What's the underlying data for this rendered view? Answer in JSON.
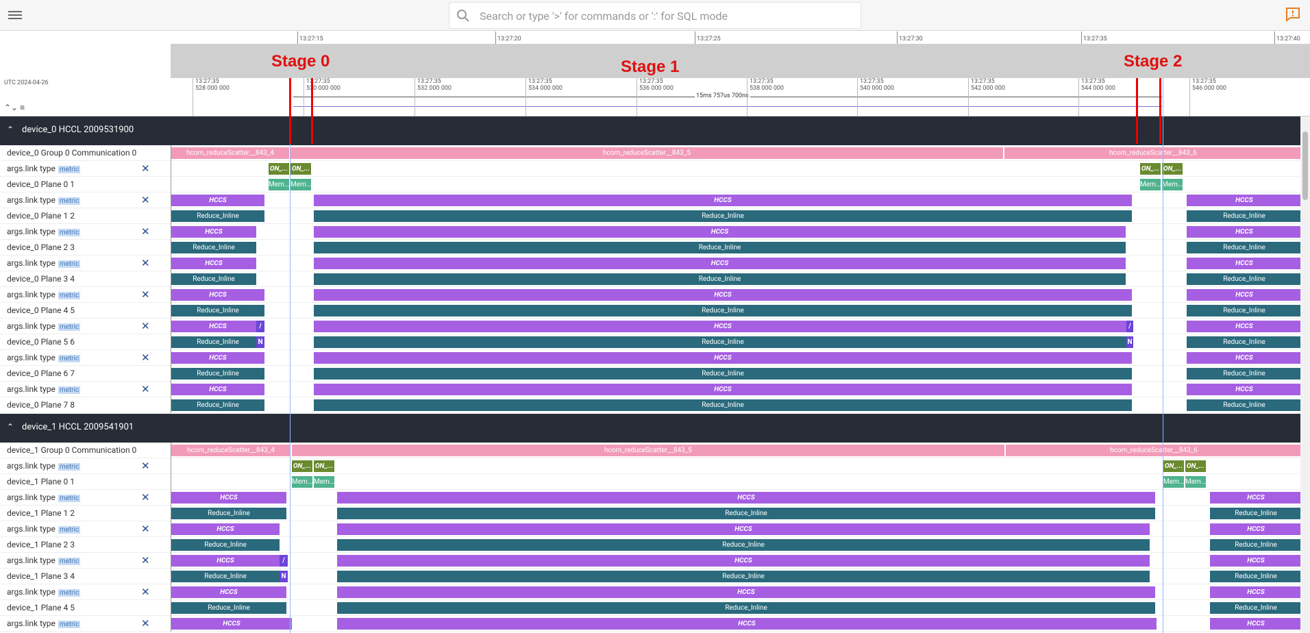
{
  "topbar": {
    "search_placeholder": "Search or type '>' for commands or ':' for SQL mode"
  },
  "overview": {
    "ticks": [
      "13:27:15",
      "13:27:20",
      "13:27:25",
      "13:27:30",
      "13:27:35",
      "13:27:40"
    ]
  },
  "timeaxis": {
    "utc": "UTC 2024-04-26",
    "ticks": [
      {
        "t": "13:27:35",
        "n": "528 000 000"
      },
      {
        "t": "13:27:35",
        "n": "530 000 000"
      },
      {
        "t": "13:27:35",
        "n": "532 000 000"
      },
      {
        "t": "13:27:35",
        "n": "534 000 000"
      },
      {
        "t": "13:27:35",
        "n": "536 000 000"
      },
      {
        "t": "13:27:35",
        "n": "538 000 000"
      },
      {
        "t": "13:27:35",
        "n": "540 000 000"
      },
      {
        "t": "13:27:35",
        "n": "542 000 000"
      },
      {
        "t": "13:27:35",
        "n": "544 000 000"
      },
      {
        "t": "13:27:35",
        "n": "546 000 000"
      }
    ],
    "span_label": "15ms 757us 700ns"
  },
  "stages": [
    "Stage 0",
    "Stage 1",
    "Stage 2"
  ],
  "groups": [
    {
      "title": "device_0 HCCL 2009531900"
    },
    {
      "title": "device_1 HCCL 2009541901"
    }
  ],
  "labels": {
    "comm0": "device_0 Group 0 Communication 0",
    "comm1": "device_1 Group 0 Communication 0",
    "link": "args.link type",
    "metric": "metric",
    "d0p": [
      "device_0 Plane 0 1",
      "device_0 Plane 1 2",
      "device_0 Plane 2 3",
      "device_0 Plane 3 4",
      "device_0 Plane 4 5",
      "device_0 Plane 5 6",
      "device_0 Plane 6 7",
      "device_0 Plane 7 8"
    ],
    "d1p": [
      "device_1 Plane 0 1",
      "device_1 Plane 1 2",
      "device_1 Plane 2 3",
      "device_1 Plane 3 4",
      "device_1 Plane 4 5"
    ]
  },
  "slices": {
    "rs4": "hcom_reduceScatter__843_4",
    "rs5": "hcom_reduceScatter__843_5",
    "rs6": "hcom_reduceScatter__843_6",
    "hccs": "HCCS",
    "reduce": "Reduce_Inline",
    "on": "ON_...",
    "mem": "Mem...",
    "n": "N",
    "slash": "/"
  }
}
